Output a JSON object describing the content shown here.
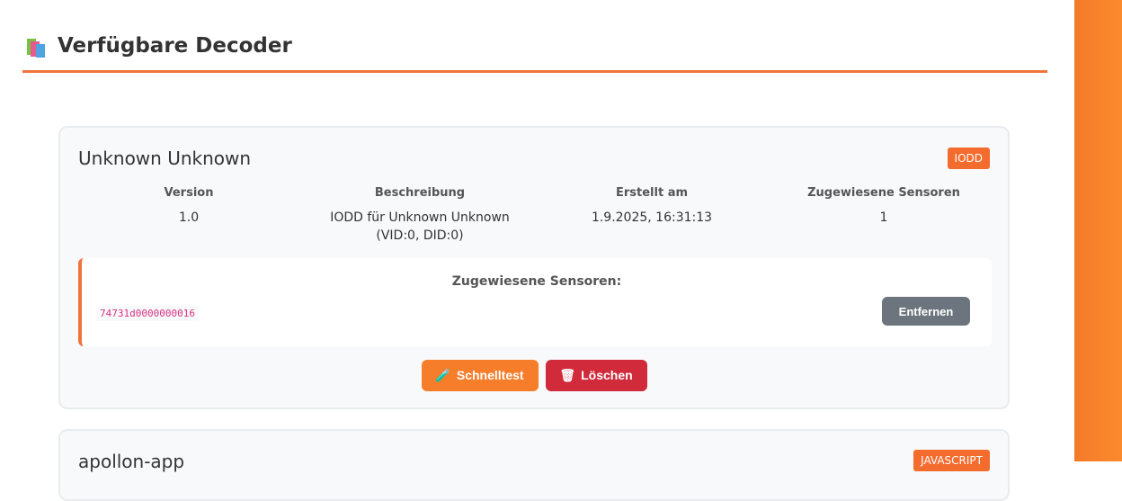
{
  "header": {
    "title": "Verfügbare Decoder",
    "icon": "books-icon"
  },
  "decoders": [
    {
      "name": "Unknown Unknown",
      "type": "IODD",
      "meta": {
        "version_label": "Version",
        "version": "1.0",
        "description_label": "Beschreibung",
        "description": "IODD für Unknown Unknown (VID:0, DID:0)",
        "created_label": "Erstellt am",
        "created": "1.9.2025, 16:31:13",
        "sensors_label": "Zugewiesene Sensoren",
        "sensors_count": "1"
      },
      "assigned": {
        "title": "Zugewiesene Sensoren:",
        "sensor_id": "74731d0000000016",
        "remove_label": "Entfernen"
      },
      "actions": {
        "quicktest_label": "Schnelltest",
        "delete_label": "Löschen"
      }
    },
    {
      "name": "apollon-app",
      "type": "JAVASCRIPT"
    }
  ],
  "colors": {
    "accent": "#f0743a",
    "danger": "#d02a3b",
    "secondary": "#6c757d"
  }
}
